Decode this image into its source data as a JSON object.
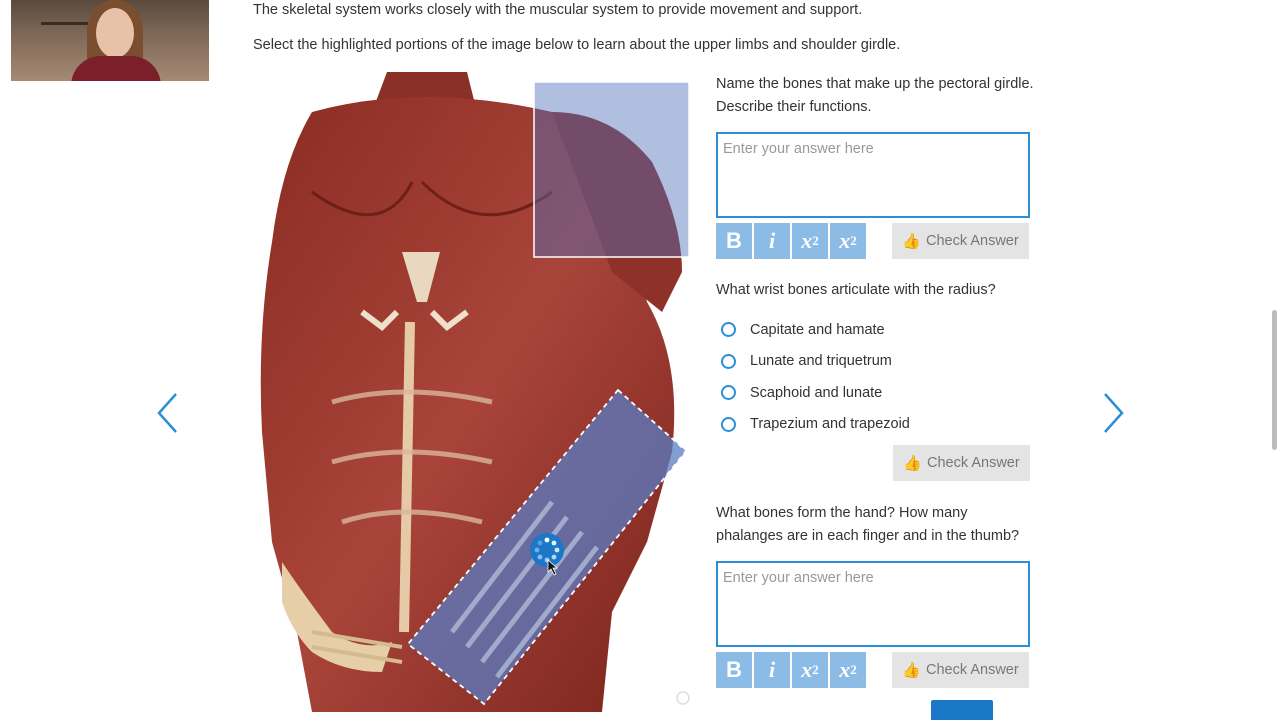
{
  "intro": {
    "line1": "The skeletal system works closely with the muscular system to provide movement and support.",
    "line2": "Select the highlighted portions of the image below to learn about the upper limbs and shoulder girdle."
  },
  "colors": {
    "accent": "#2b8fd6",
    "format_button": "#8cbce6",
    "check_button": "#e4e4e4",
    "hotspot": "#5a7cc4"
  },
  "q1": {
    "prompt": "Name the bones that make up the pectoral girdle. Describe their functions.",
    "placeholder": "Enter your answer here"
  },
  "q2": {
    "prompt": "What wrist bones articulate with the radius?",
    "options": [
      "Capitate and hamate",
      "Lunate and triquetrum",
      "Scaphoid and lunate",
      "Trapezium and trapezoid"
    ]
  },
  "q3": {
    "prompt": "What bones form the hand? How many phalanges are in each finger and in the thumb?",
    "placeholder": "Enter your answer here"
  },
  "toolbar": {
    "bold": "B",
    "italic": "i",
    "subscript_base": "x",
    "subscript": "2",
    "superscript_base": "x",
    "superscript": "2",
    "check_label": "Check Answer"
  },
  "icons": {
    "prev": "chevron-left-icon",
    "next": "chevron-right-icon",
    "check": "thumbs-up-icon",
    "loading": "spinner-icon"
  }
}
